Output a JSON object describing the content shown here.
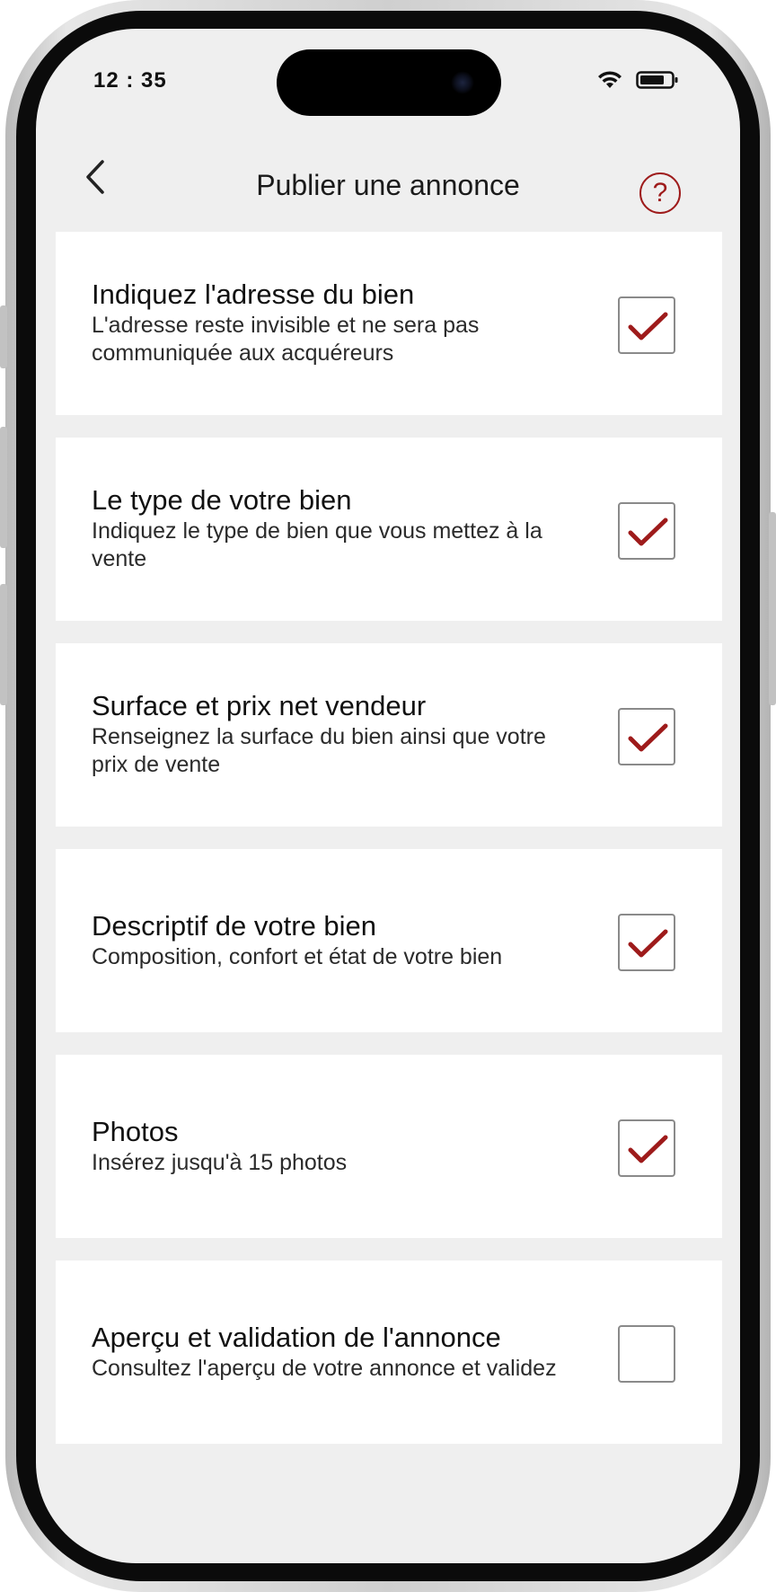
{
  "status_bar": {
    "time": "12 : 35",
    "icons": [
      "wifi-icon",
      "battery-icon"
    ]
  },
  "header": {
    "title": "Publier une annonce",
    "back_icon": "chevron-left-icon",
    "help_label": "?"
  },
  "colors": {
    "accent": "#9e1b1b",
    "background": "#efefef",
    "card": "#ffffff"
  },
  "steps": [
    {
      "title": "Indiquez l'adresse du bien",
      "subtitle": "L'adresse reste invisible et ne sera pas communiquée aux acquéreurs",
      "checked": true
    },
    {
      "title": "Le type de votre bien",
      "subtitle": "Indiquez le type de bien que vous mettez à la vente",
      "checked": true
    },
    {
      "title": "Surface et prix net vendeur",
      "subtitle": "Renseignez la surface du bien ainsi que votre prix de vente",
      "checked": true
    },
    {
      "title": "Descriptif de votre bien",
      "subtitle": "Composition, confort et état de votre bien",
      "checked": true
    },
    {
      "title": "Photos",
      "subtitle": "Insérez jusqu'à 15 photos",
      "checked": true
    },
    {
      "title": "Aperçu et validation de l'annonce",
      "subtitle": "Consultez l'aperçu de votre annonce et validez",
      "checked": false
    }
  ]
}
